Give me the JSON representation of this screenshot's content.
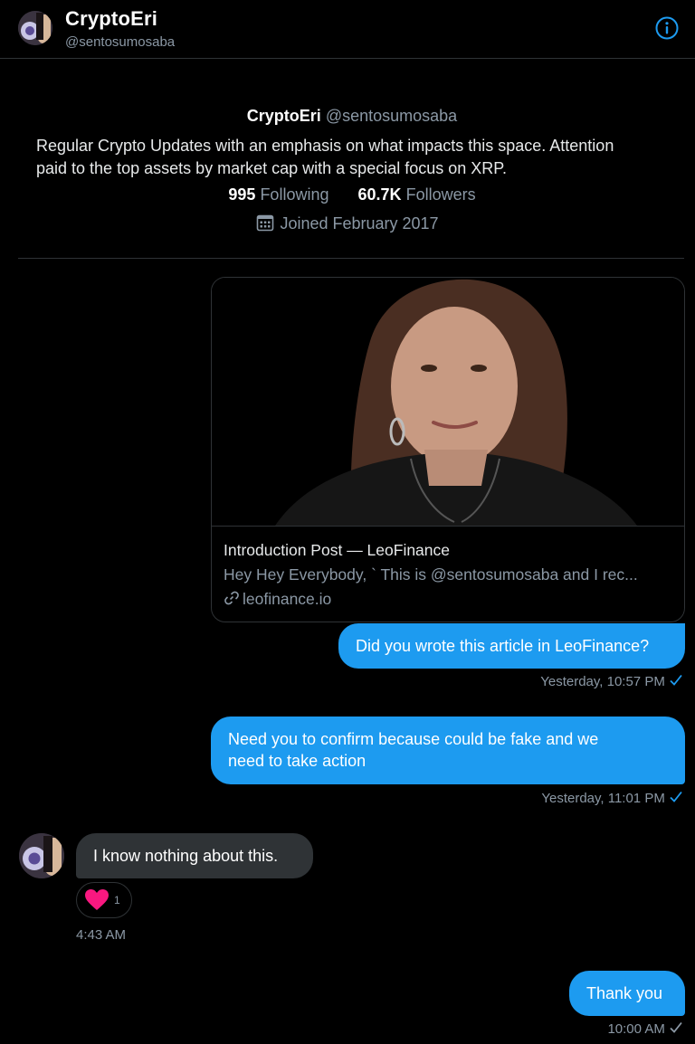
{
  "header": {
    "name": "CryptoEri",
    "handle": "@sentosumosaba"
  },
  "profile": {
    "name": "CryptoEri",
    "handle": "@sentosumosaba",
    "bio_line1": "Regular Crypto Updates with an emphasis on what impacts this space. Attention",
    "bio_line2": "paid to the top assets by market cap with a special focus on XRP.",
    "following_count": "995",
    "following_label": "Following",
    "followers_count": "60.7K",
    "followers_label": "Followers",
    "joined": "Joined February 2017"
  },
  "link_card": {
    "title": "Introduction Post — LeoFinance",
    "description": "Hey Hey Everybody, ` This is @sentosumosaba and I rec...",
    "domain": "leofinance.io"
  },
  "messages": [
    {
      "text": "Did you wrote this article in LeoFinance?",
      "timestamp": "Yesterday, 10:57 PM"
    },
    {
      "text_line1": "Need you to confirm because could be fake and we",
      "text_line2": "need to take action",
      "timestamp": "Yesterday, 11:01 PM"
    },
    {
      "text": "I know nothing about this.",
      "reaction_count": "1",
      "timestamp": "4:43 AM"
    },
    {
      "text": "Thank you",
      "timestamp": "10:00 AM"
    }
  ],
  "colors": {
    "accent": "#1d9bf0",
    "background": "#000000",
    "incoming_bubble": "#2f3336",
    "muted": "#8b98a5",
    "heart": "#f91880"
  },
  "icons": {
    "info": "info-icon",
    "calendar": "calendar-icon",
    "link": "link-icon",
    "check": "checkmark-icon",
    "heart": "heart-icon"
  }
}
